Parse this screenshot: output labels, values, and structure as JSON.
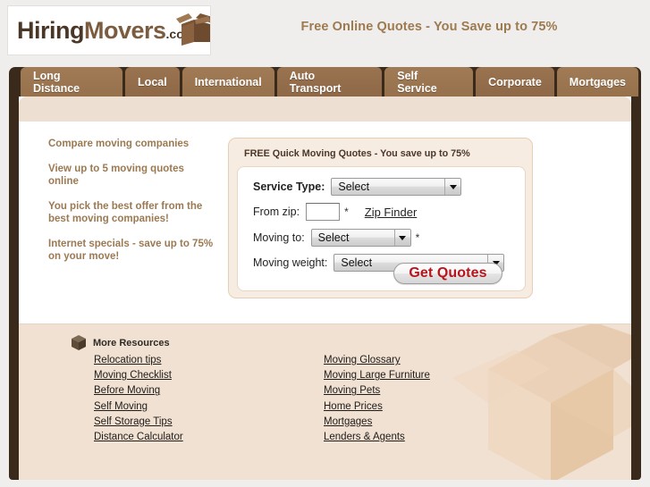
{
  "header": {
    "logo": {
      "part1": "Hiring",
      "part2": "Movers",
      "part3": ".com",
      "icon": "cardboard-box-icon"
    },
    "tagline": "Free Online Quotes - You Save up to 75%"
  },
  "nav": {
    "tabs": [
      {
        "label": "Long Distance"
      },
      {
        "label": "Local"
      },
      {
        "label": "International"
      },
      {
        "label": "Auto Transport"
      },
      {
        "label": "Self Service"
      },
      {
        "label": "Corporate"
      },
      {
        "label": "Mortgages"
      }
    ]
  },
  "sidebar": {
    "bullets": [
      "Compare moving companies",
      "View up to 5 moving quotes online",
      "You pick the best offer from the best moving companies!",
      "Internet specials - save up to 75% on your move!"
    ]
  },
  "quote_form": {
    "title": "FREE Quick Moving Quotes - You save up to 75%",
    "service_type": {
      "label": "Service Type:",
      "value": "Select"
    },
    "from_zip": {
      "label": "From zip:",
      "value": "",
      "placeholder": "",
      "required_mark": "*",
      "zip_finder_link": "Zip Finder"
    },
    "moving_to": {
      "label": "Moving to:",
      "value": "Select",
      "required_mark": "*"
    },
    "moving_weight": {
      "label": "Moving weight:",
      "value": "Select"
    },
    "submit_label": "Get Quotes"
  },
  "resources": {
    "heading": "More Resources",
    "heading_icon": "cube-icon",
    "left_links": [
      "Relocation tips",
      "Moving Checklist",
      "Before Moving",
      "Self Moving",
      "Self Storage Tips",
      "Distance Calculator"
    ],
    "right_links": [
      "Moving Glossary",
      "Moving Large Furniture",
      "Moving Pets",
      "Home Prices",
      "Mortgages",
      "Lenders & Agents"
    ]
  },
  "colors": {
    "page_bg": "#efeeec",
    "frame_dark": "#3a2a1c",
    "tab_brown": "#9a7550",
    "tagline": "#9d7a50",
    "bullet_text": "#9b7a53",
    "quotebox_bg": "#f7ece1",
    "footer_bg": "#f0e1d2",
    "submit_text": "#b8141b"
  }
}
